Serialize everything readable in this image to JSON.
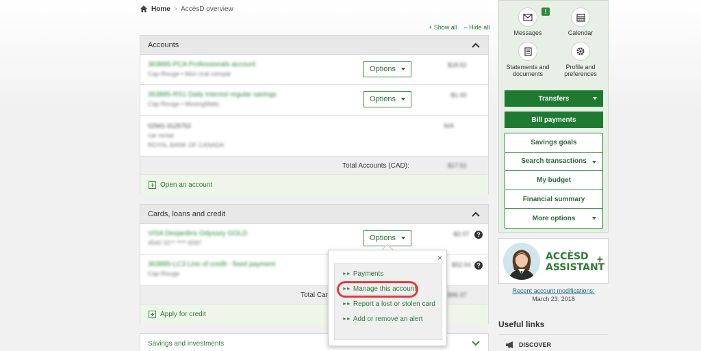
{
  "breadcrumb": {
    "home": "Home",
    "separator": ">",
    "current": "AccèsD overview"
  },
  "controls": {
    "show_all": "+ Show all",
    "hide_all": "– Hide all"
  },
  "accounts": {
    "title": "Accounts",
    "rows": [
      {
        "name": "363885-PCA Professionals account",
        "sub": "Cap-Rouge  •  Mon oral compte",
        "balance": "$18.52",
        "options": "Options"
      },
      {
        "name": "363885-RS1 Daily Interest regular savings",
        "sub": "Cap-Rouge  •  MovingMatic",
        "balance": "-$1.00",
        "options": "Options"
      },
      {
        "name": "02941-3125752",
        "line2": "car rental",
        "line3": "ROYAL BANK OF CANADA",
        "balance": "N/A"
      }
    ],
    "total_label": "Total Accounts (CAD):",
    "total_value": "$17.52",
    "open_account": "Open an account"
  },
  "cards": {
    "title": "Cards, loans and credit",
    "rows": [
      {
        "name": "VISA Desjardins Odyssey GOLD",
        "sub": "4540 31** **** 6097",
        "balance": "-$2.07",
        "options": "Options"
      },
      {
        "name": "363885-LC3 Line of credit - fixed payment",
        "sub": "Cap-Rouge",
        "balance": "$52.04"
      }
    ],
    "total_label": "Total Car",
    "total_value": "$96.37",
    "apply_credit": "Apply for credit",
    "help": "?"
  },
  "savings": {
    "title": "Savings and investments"
  },
  "popup": {
    "close": "×",
    "items": [
      "Payments",
      "Manage this account",
      "Report a lost or stolen card",
      "Add or remove an alert"
    ]
  },
  "sidebar": {
    "messages": "Messages",
    "messages_badge": "!",
    "calendar": "Calendar",
    "statements": "Statements and documents",
    "profile": "Profile and preferences",
    "transfers": "Transfers",
    "bill_payments": "Bill payments",
    "links": [
      "Savings goals",
      "Search transactions",
      "My budget",
      "Financial summary",
      "More options"
    ]
  },
  "assistant": {
    "line1": "ACCÈSD",
    "line2": "ASSISTANT",
    "plus": "+"
  },
  "recent": {
    "link": "Recent account modifications:",
    "date": "March 23, 2018"
  },
  "useful_links": {
    "title": "Useful links",
    "discover": "DISCOVER"
  },
  "colors": {
    "brand_green": "#1d7a30",
    "link_green": "#2e7a36",
    "highlight_red": "#e03a3a"
  }
}
